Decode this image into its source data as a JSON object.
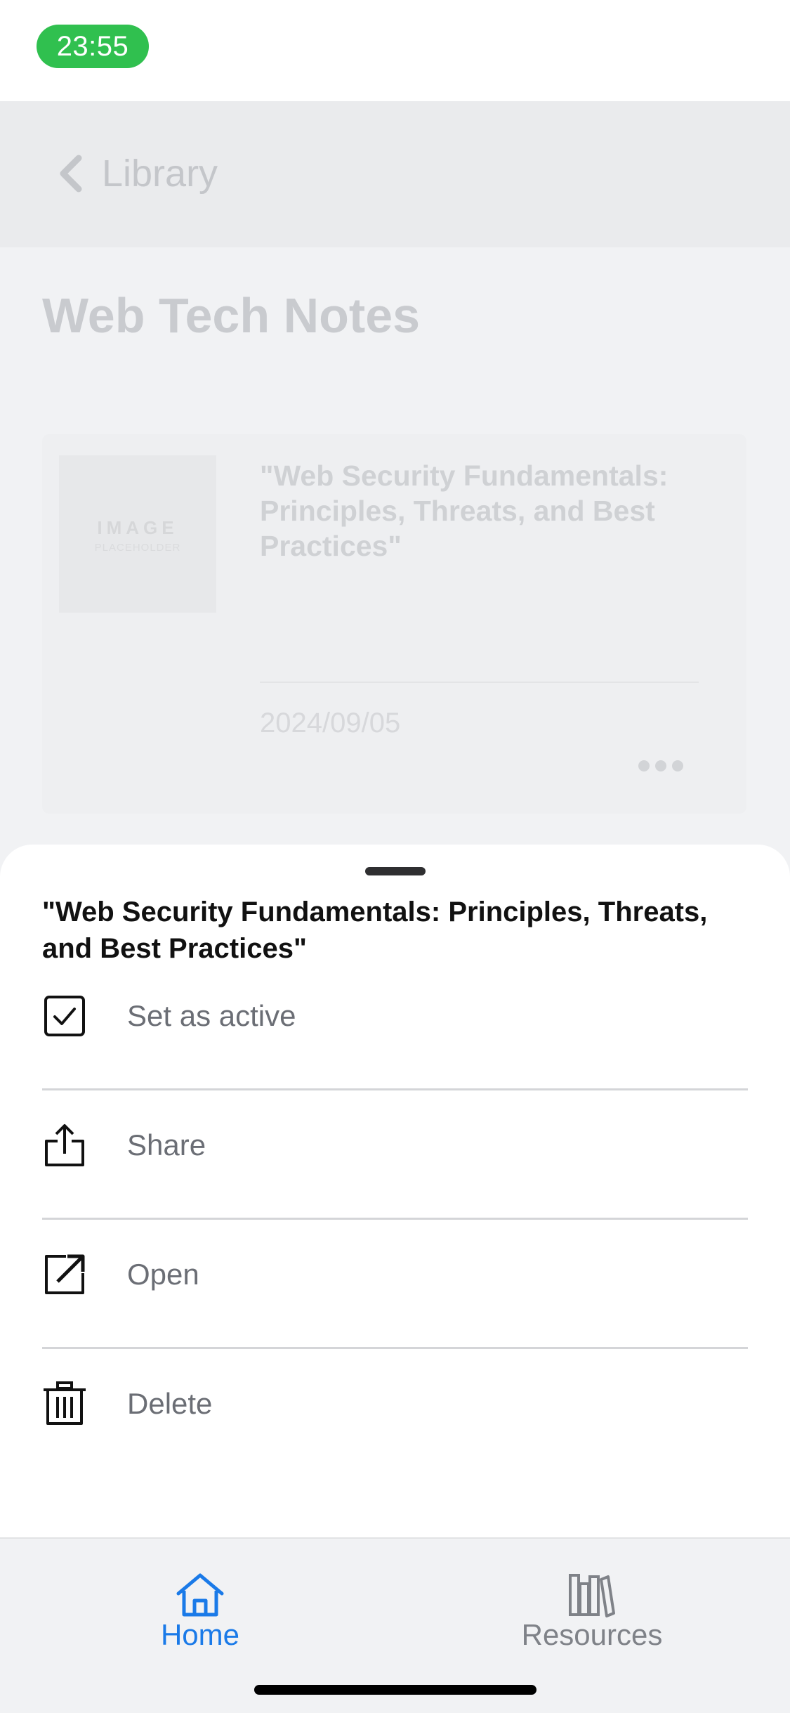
{
  "status_bar": {
    "time": "23:55"
  },
  "nav": {
    "back_label": "Library"
  },
  "page": {
    "title": "Web Tech Notes"
  },
  "card": {
    "thumbnail_text": "IMAGE",
    "thumbnail_subtext": "PLACEHOLDER",
    "title": "\"Web Security Fundamentals: Principles, Threats, and Best Practices\"",
    "date": "2024/09/05",
    "more_icon": "ellipsis-icon"
  },
  "sheet": {
    "title": "\"Web Security Fundamentals: Principles, Threats, and Best Practices\"",
    "actions": [
      {
        "label": "Set as active",
        "icon": "checkbox-icon"
      },
      {
        "label": "Share",
        "icon": "share-icon"
      },
      {
        "label": "Open",
        "icon": "open-external-icon"
      },
      {
        "label": "Delete",
        "icon": "trash-icon"
      }
    ]
  },
  "tabs": [
    {
      "label": "Home",
      "icon": "home-icon",
      "active": true
    },
    {
      "label": "Resources",
      "icon": "books-icon",
      "active": false
    }
  ],
  "colors": {
    "accent": "#1a7ae8",
    "status_pill": "#30c04f",
    "inactive_tab": "#7f8288"
  }
}
